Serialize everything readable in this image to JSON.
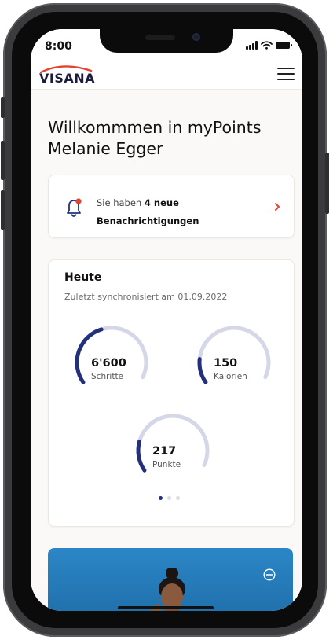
{
  "status_bar": {
    "time": "8:00"
  },
  "header": {
    "logo_text": "VISANA",
    "menu_icon": "hamburger-menu-icon",
    "brand_accent": "#e2442f"
  },
  "welcome": {
    "line1": "Willkommmen in myPoints",
    "line2": "Melanie Egger"
  },
  "notification": {
    "prefix": "Sie haben ",
    "count_bold": "4 neue",
    "label_bold": "Benachrichtigungen",
    "icon": "bell-icon",
    "chevron_icon": "chevron-right-icon",
    "accent": "#e2442f",
    "icon_color": "#23307a"
  },
  "today": {
    "title": "Heute",
    "sync": "Zuletzt synchronisiert am 01.09.2022",
    "metrics": [
      {
        "value": "6'600",
        "label": "Schritte",
        "progress": 0.45
      },
      {
        "value": "150",
        "label": "Kalorien",
        "progress": 0.17
      },
      {
        "value": "217",
        "label": "Punkte",
        "progress": 0.21
      }
    ],
    "pager": {
      "count": 3,
      "active": 0
    },
    "arc_color": "#23307a",
    "track_color": "#d5d6e8"
  },
  "promo": {
    "collapse_icon": "minus-circle-icon"
  }
}
